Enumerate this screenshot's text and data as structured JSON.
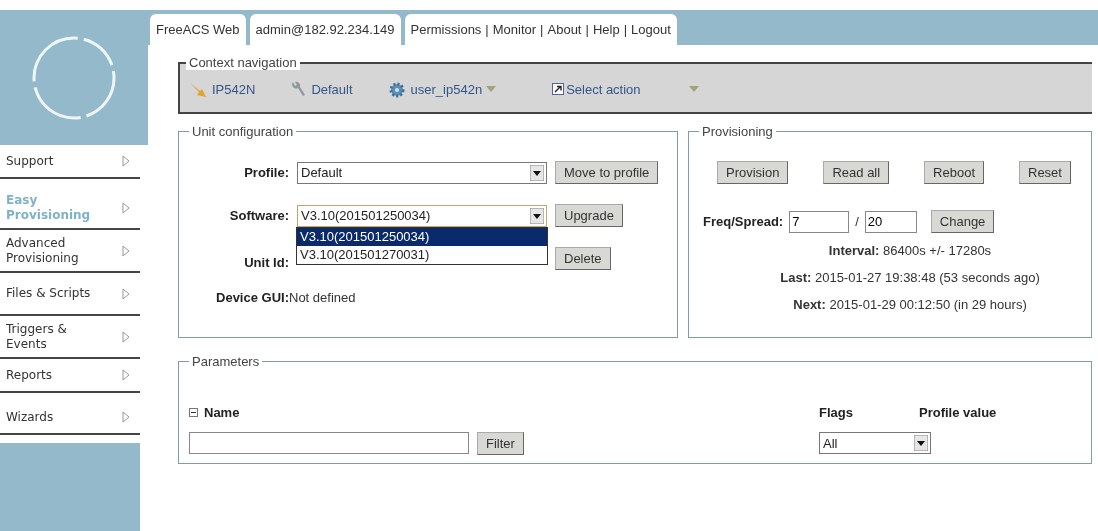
{
  "header": {
    "tabs": [
      "FreeACS Web",
      "admin@182.92.234.149"
    ],
    "links": [
      "Permissions",
      "Monitor",
      "About",
      "Help",
      "Logout"
    ],
    "separator": "|"
  },
  "sidebar": {
    "items": [
      {
        "label": "Support",
        "selected": false
      },
      {
        "label": "Easy Provisioning",
        "selected": true
      },
      {
        "label": "Advanced Provisioning",
        "selected": false
      },
      {
        "label": "Files & Scripts",
        "selected": false
      },
      {
        "label": "Triggers & Events",
        "selected": false
      },
      {
        "label": "Reports",
        "selected": false
      },
      {
        "label": "Wizards",
        "selected": false
      }
    ]
  },
  "context_navigation": {
    "title": "Context navigation",
    "items": [
      {
        "kind": "unittype",
        "label": "IP542N"
      },
      {
        "kind": "profile",
        "label": "Default"
      },
      {
        "kind": "unit",
        "label": "user_ip542n"
      }
    ],
    "action": "Select action"
  },
  "unit_configuration": {
    "title": "Unit configuration",
    "profile": {
      "label": "Profile:",
      "value": "Default",
      "button": "Move to profile"
    },
    "software": {
      "label": "Software:",
      "value": "V3.10(201501250034)",
      "button": "Upgrade",
      "expanded": true,
      "options": [
        {
          "label": "V3.10(201501250034)",
          "selected": true
        },
        {
          "label": "V3.10(201501270031)",
          "selected": false
        }
      ]
    },
    "unit_id": {
      "label": "Unit Id:",
      "button": "Delete"
    },
    "device_gui": {
      "label": "Device GUI:",
      "value": "Not defined"
    }
  },
  "provisioning": {
    "title": "Provisioning",
    "buttons": [
      "Provision",
      "Read all",
      "Reboot",
      "Reset"
    ],
    "freq_spread": {
      "label": "Freq/Spread:",
      "freq": "7",
      "separator": "/",
      "spread": "20",
      "button": "Change"
    },
    "info": [
      {
        "label": "Interval:",
        "value": "86400s +/- 17280s"
      },
      {
        "label": "Last:",
        "value": "2015-01-27 19:38:48 (53 seconds ago)"
      },
      {
        "label": "Next:",
        "value": "2015-01-29 00:12:50 (in 29 hours)"
      }
    ]
  },
  "parameters": {
    "title": "Parameters",
    "columns": [
      "Name",
      "Flags",
      "Profile value"
    ],
    "filter_button": "Filter",
    "flags_value": "All"
  }
}
